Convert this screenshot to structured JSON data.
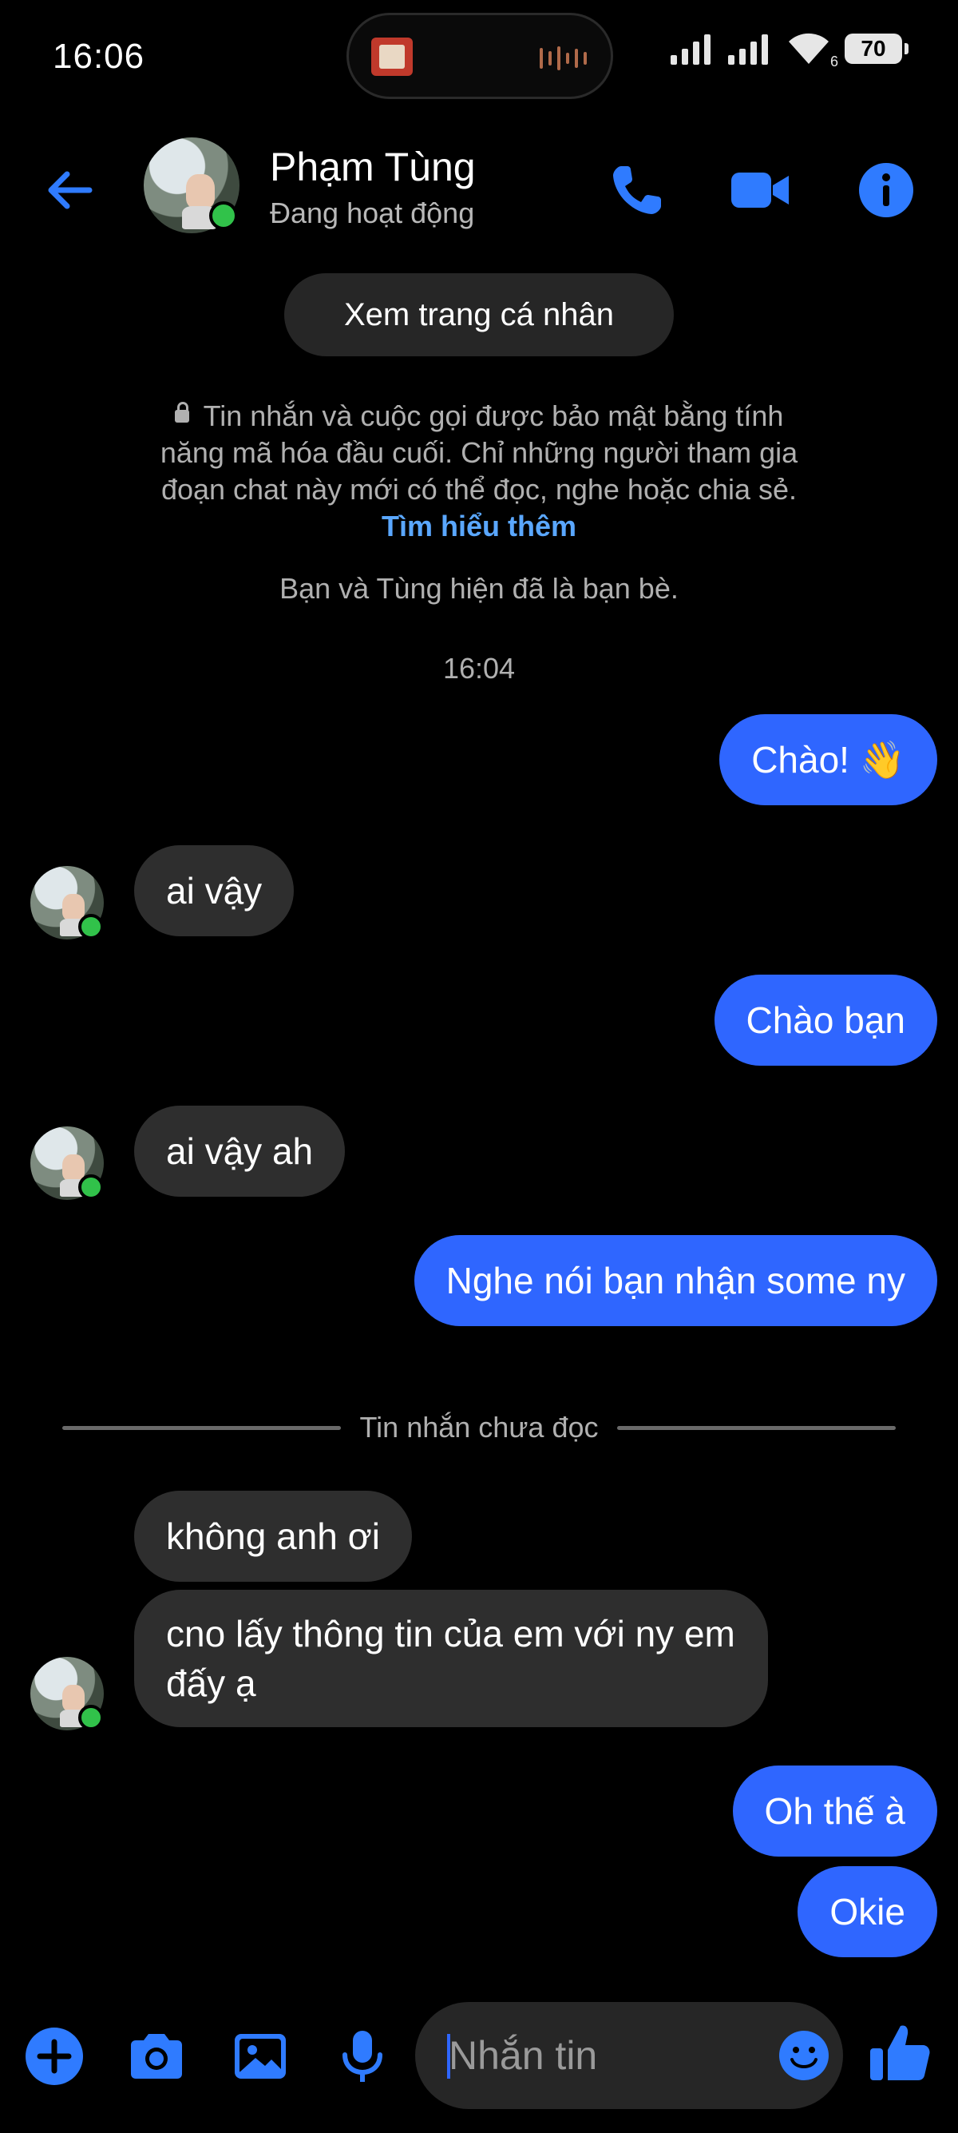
{
  "status_bar": {
    "time": "16:06",
    "battery": "70",
    "wifi_badge": "6"
  },
  "header": {
    "name": "Phạm Tùng",
    "status": "Đang hoạt động"
  },
  "profile_button": "Xem trang cá nhân",
  "e2ee": {
    "text": "Tin nhắn và cuộc gọi được bảo mật bằng tính năng mã hóa đầu cuối. Chỉ những người tham gia đoạn chat này mới có thể đọc, nghe hoặc chia sẻ.",
    "link": "Tìm hiểu thêm"
  },
  "friends_note": "Bạn và Tùng hiện đã là bạn bè.",
  "timestamp": "16:04",
  "messages": [
    {
      "dir": "out",
      "text": "Chào! 👋"
    },
    {
      "dir": "in",
      "text": "ai vậy"
    },
    {
      "dir": "out",
      "text": "Chào bạn"
    },
    {
      "dir": "in",
      "text": "ai vậy ah"
    },
    {
      "dir": "out",
      "text": "Nghe nói bạn nhận some ny"
    },
    {
      "dir": "in",
      "text": "không anh ơi"
    },
    {
      "dir": "in",
      "text": "cno lấy thông tin của em với ny em đấy ạ"
    },
    {
      "dir": "out",
      "text": "Oh thế à"
    },
    {
      "dir": "out",
      "text": "Okie"
    }
  ],
  "unread_divider": "Tin nhắn chưa đọc",
  "composer": {
    "placeholder": "Nhắn tin"
  },
  "colors": {
    "accent": "#2f66ff",
    "online": "#31c24a",
    "incoming_bubble": "#2e2e2e",
    "background": "#000000"
  }
}
